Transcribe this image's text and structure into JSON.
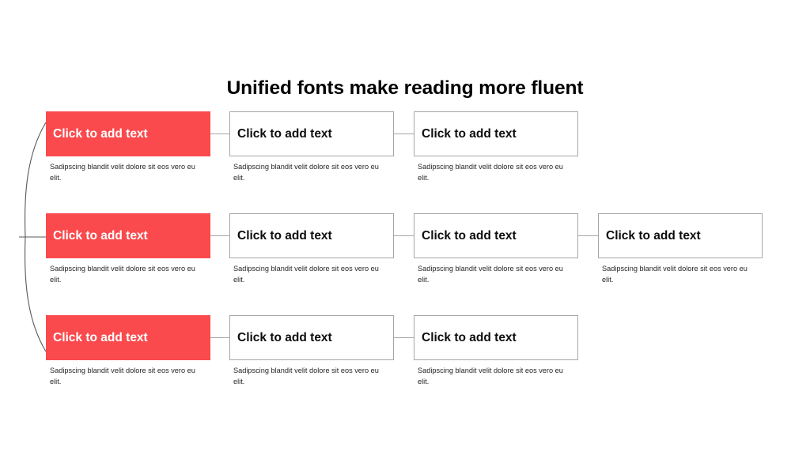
{
  "slide": {
    "title": "Unified fonts make reading more fluent",
    "background_color": "#ffffff",
    "accent_color": "#fa4a4d",
    "border_color": "#a6a6a6",
    "text_color": "#000000",
    "accent_text_color": "#ffffff",
    "description_color": "#262626"
  },
  "common": {
    "node_label": "Click to add text",
    "node_description": "Sadipscing blandit velit dolore sit eos vero eu elit."
  },
  "diagram": {
    "type": "horizontal-tree",
    "brace": {
      "name": "left-brace-connector",
      "color": "#595959"
    },
    "rows": [
      {
        "id": "row-1",
        "nodes": [
          {
            "style": "accent",
            "label": "Click to add text",
            "description": "Sadipscing blandit velit dolore sit eos vero eu elit."
          },
          {
            "style": "plain",
            "label": "Click to add text",
            "description": "Sadipscing blandit velit dolore sit eos vero eu elit."
          },
          {
            "style": "plain",
            "label": "Click to add text",
            "description": "Sadipscing blandit velit dolore sit eos vero eu elit."
          }
        ]
      },
      {
        "id": "row-2",
        "nodes": [
          {
            "style": "accent",
            "label": "Click to add text",
            "description": "Sadipscing blandit velit dolore sit eos vero eu elit."
          },
          {
            "style": "plain",
            "label": "Click to add text",
            "description": "Sadipscing blandit velit dolore sit eos vero eu elit."
          },
          {
            "style": "plain",
            "label": "Click to add text",
            "description": "Sadipscing blandit velit dolore sit eos vero eu elit."
          },
          {
            "style": "plain",
            "label": "Click to add text",
            "description": "Sadipscing blandit velit dolore sit eos vero eu elit."
          }
        ]
      },
      {
        "id": "row-3",
        "nodes": [
          {
            "style": "accent",
            "label": "Click to add text",
            "description": "Sadipscing blandit velit dolore sit eos vero eu elit."
          },
          {
            "style": "plain",
            "label": "Click to add text",
            "description": "Sadipscing blandit velit dolore sit eos vero eu elit."
          },
          {
            "style": "plain",
            "label": "Click to add text",
            "description": "Sadipscing blandit velit dolore sit eos vero eu elit."
          }
        ]
      }
    ]
  }
}
